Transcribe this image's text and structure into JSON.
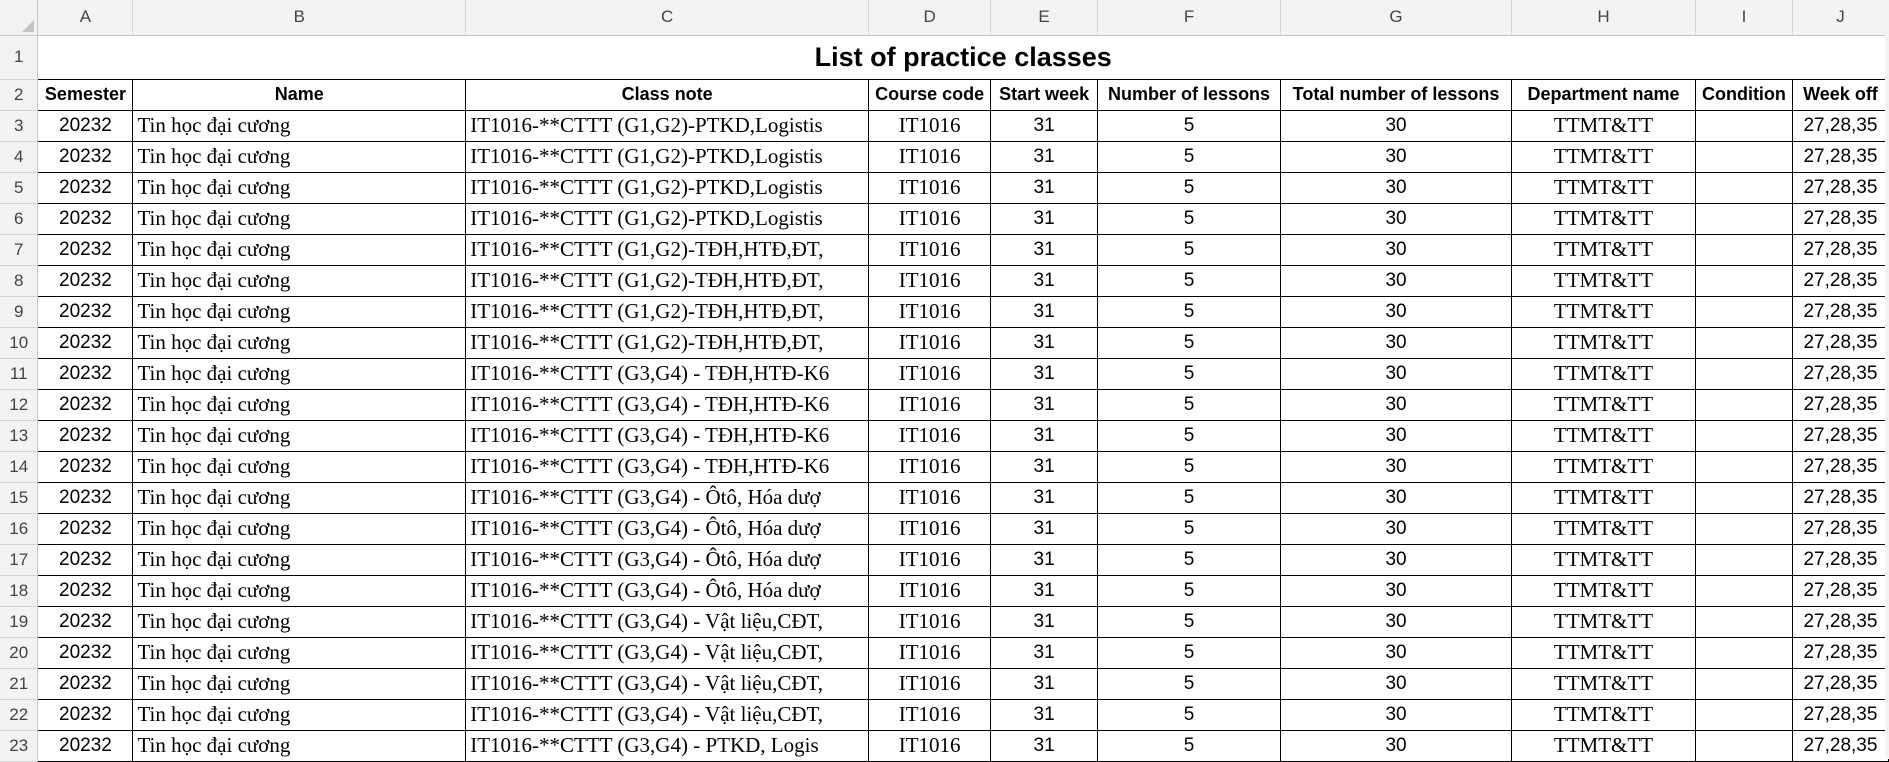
{
  "sheet": {
    "columns": [
      "A",
      "B",
      "C",
      "D",
      "E",
      "F",
      "G",
      "H",
      "I",
      "J"
    ],
    "title": "List of practice classes",
    "headers": [
      "Semester",
      "Name",
      "Class note",
      "Course code",
      "Start week",
      "Number of lessons",
      "Total number of lessons",
      "Department name",
      "Condition",
      "Week off"
    ],
    "rows": [
      {
        "num": "3",
        "cells": [
          "20232",
          "Tin học đại cương",
          "IT1016-**CTTT (G1,G2)-PTKD,Logistis",
          "IT1016",
          "31",
          "5",
          "30",
          "TTMT&TT",
          "",
          "27,28,35"
        ]
      },
      {
        "num": "4",
        "cells": [
          "20232",
          "Tin học đại cương",
          "IT1016-**CTTT (G1,G2)-PTKD,Logistis",
          "IT1016",
          "31",
          "5",
          "30",
          "TTMT&TT",
          "",
          "27,28,35"
        ]
      },
      {
        "num": "5",
        "cells": [
          "20232",
          "Tin học đại cương",
          "IT1016-**CTTT (G1,G2)-PTKD,Logistis",
          "IT1016",
          "31",
          "5",
          "30",
          "TTMT&TT",
          "",
          "27,28,35"
        ]
      },
      {
        "num": "6",
        "cells": [
          "20232",
          "Tin học đại cương",
          "IT1016-**CTTT (G1,G2)-PTKD,Logistis",
          "IT1016",
          "31",
          "5",
          "30",
          "TTMT&TT",
          "",
          "27,28,35"
        ]
      },
      {
        "num": "7",
        "cells": [
          "20232",
          "Tin học đại cương",
          "IT1016-**CTTT (G1,G2)-TĐH,HTĐ,ĐT,",
          "IT1016",
          "31",
          "5",
          "30",
          "TTMT&TT",
          "",
          "27,28,35"
        ]
      },
      {
        "num": "8",
        "cells": [
          "20232",
          "Tin học đại cương",
          "IT1016-**CTTT (G1,G2)-TĐH,HTĐ,ĐT,",
          "IT1016",
          "31",
          "5",
          "30",
          "TTMT&TT",
          "",
          "27,28,35"
        ]
      },
      {
        "num": "9",
        "cells": [
          "20232",
          "Tin học đại cương",
          "IT1016-**CTTT (G1,G2)-TĐH,HTĐ,ĐT,",
          "IT1016",
          "31",
          "5",
          "30",
          "TTMT&TT",
          "",
          "27,28,35"
        ]
      },
      {
        "num": "10",
        "cells": [
          "20232",
          "Tin học đại cương",
          "IT1016-**CTTT (G1,G2)-TĐH,HTĐ,ĐT,",
          "IT1016",
          "31",
          "5",
          "30",
          "TTMT&TT",
          "",
          "27,28,35"
        ]
      },
      {
        "num": "11",
        "cells": [
          "20232",
          "Tin học đại cương",
          "IT1016-**CTTT (G3,G4) - TĐH,HTĐ-K6",
          "IT1016",
          "31",
          "5",
          "30",
          "TTMT&TT",
          "",
          "27,28,35"
        ]
      },
      {
        "num": "12",
        "cells": [
          "20232",
          "Tin học đại cương",
          "IT1016-**CTTT (G3,G4) - TĐH,HTĐ-K6",
          "IT1016",
          "31",
          "5",
          "30",
          "TTMT&TT",
          "",
          "27,28,35"
        ]
      },
      {
        "num": "13",
        "cells": [
          "20232",
          "Tin học đại cương",
          "IT1016-**CTTT (G3,G4) - TĐH,HTĐ-K6",
          "IT1016",
          "31",
          "5",
          "30",
          "TTMT&TT",
          "",
          "27,28,35"
        ]
      },
      {
        "num": "14",
        "cells": [
          "20232",
          "Tin học đại cương",
          "IT1016-**CTTT (G3,G4) - TĐH,HTĐ-K6",
          "IT1016",
          "31",
          "5",
          "30",
          "TTMT&TT",
          "",
          "27,28,35"
        ]
      },
      {
        "num": "15",
        "cells": [
          "20232",
          "Tin học đại cương",
          "IT1016-**CTTT (G3,G4) - Ôtô, Hóa dượ",
          "IT1016",
          "31",
          "5",
          "30",
          "TTMT&TT",
          "",
          "27,28,35"
        ]
      },
      {
        "num": "16",
        "cells": [
          "20232",
          "Tin học đại cương",
          "IT1016-**CTTT (G3,G4) - Ôtô, Hóa dượ",
          "IT1016",
          "31",
          "5",
          "30",
          "TTMT&TT",
          "",
          "27,28,35"
        ]
      },
      {
        "num": "17",
        "cells": [
          "20232",
          "Tin học đại cương",
          "IT1016-**CTTT (G3,G4) - Ôtô, Hóa dượ",
          "IT1016",
          "31",
          "5",
          "30",
          "TTMT&TT",
          "",
          "27,28,35"
        ]
      },
      {
        "num": "18",
        "cells": [
          "20232",
          "Tin học đại cương",
          "IT1016-**CTTT (G3,G4) - Ôtô, Hóa dượ",
          "IT1016",
          "31",
          "5",
          "30",
          "TTMT&TT",
          "",
          "27,28,35"
        ]
      },
      {
        "num": "19",
        "cells": [
          "20232",
          "Tin học đại cương",
          "IT1016-**CTTT (G3,G4) - Vật liệu,CĐT,",
          "IT1016",
          "31",
          "5",
          "30",
          "TTMT&TT",
          "",
          "27,28,35"
        ]
      },
      {
        "num": "20",
        "cells": [
          "20232",
          "Tin học đại cương",
          "IT1016-**CTTT (G3,G4) - Vật liệu,CĐT,",
          "IT1016",
          "31",
          "5",
          "30",
          "TTMT&TT",
          "",
          "27,28,35"
        ]
      },
      {
        "num": "21",
        "cells": [
          "20232",
          "Tin học đại cương",
          "IT1016-**CTTT (G3,G4) - Vật liệu,CĐT,",
          "IT1016",
          "31",
          "5",
          "30",
          "TTMT&TT",
          "",
          "27,28,35"
        ]
      },
      {
        "num": "22",
        "cells": [
          "20232",
          "Tin học đại cương",
          "IT1016-**CTTT (G3,G4) - Vật liệu,CĐT,",
          "IT1016",
          "31",
          "5",
          "30",
          "TTMT&TT",
          "",
          "27,28,35"
        ]
      },
      {
        "num": "23",
        "cells": [
          "20232",
          "Tin học đại cương",
          "IT1016-**CTTT (G3,G4) - PTKD,  Logis",
          "IT1016",
          "31",
          "5",
          "30",
          "TTMT&TT",
          "",
          "27,28,35"
        ]
      }
    ]
  }
}
